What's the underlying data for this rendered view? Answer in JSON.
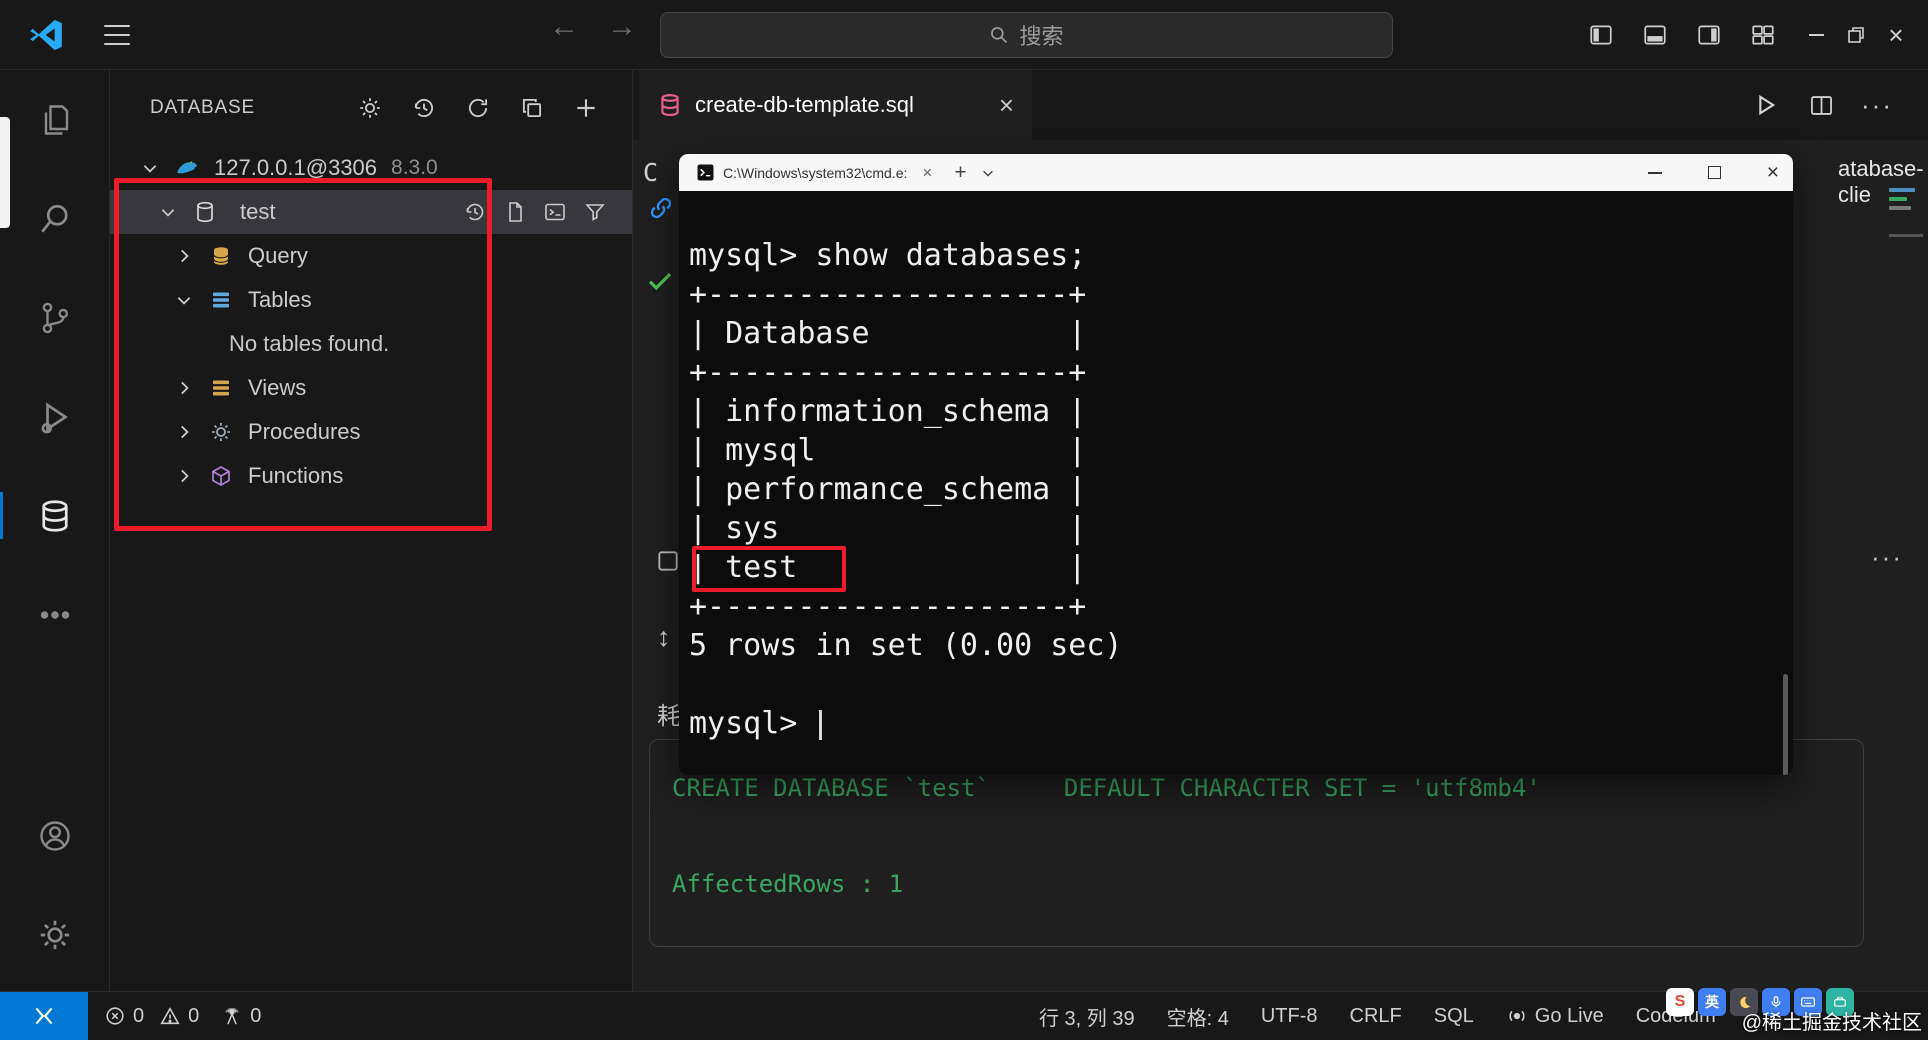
{
  "titlebar": {
    "search_placeholder": "搜索"
  },
  "icons": {
    "back": "←",
    "forward": "→",
    "close": "×",
    "plus": "+",
    "dots": "···",
    "updown": "↕"
  },
  "sidebar": {
    "title": "DATABASE",
    "connection": {
      "host": "127.0.0.1@3306",
      "version": "8.3.0"
    },
    "tree": [
      {
        "label": "test"
      },
      {
        "label": "Query"
      },
      {
        "label": "Tables"
      },
      {
        "label": "No tables found."
      },
      {
        "label": "Views"
      },
      {
        "label": "Procedures"
      },
      {
        "label": "Functions"
      }
    ]
  },
  "editor": {
    "tab_title": "create-db-template.sql",
    "fragment_line1": "C",
    "fragment_elapsed": "耗",
    "right_fragment": "atabase-clie",
    "results": {
      "statement": "CREATE DATABASE `test`",
      "statement_tail": "DEFAULT CHARACTER SET = 'utf8mb4'",
      "affected_rows": "AffectedRows : 1"
    }
  },
  "terminal": {
    "window_title": "C:\\Windows\\system32\\cmd.e:",
    "lines": [
      "mysql> show databases;",
      "+--------------------+",
      "| Database           |",
      "+--------------------+",
      "| information_schema |",
      "| mysql              |",
      "| performance_schema |",
      "| sys                |",
      "| test               |",
      "+--------------------+",
      "5 rows in set (0.00 sec)",
      "",
      "mysql>"
    ]
  },
  "status_bar": {
    "errors": "0",
    "warnings": "0",
    "ports": "0",
    "cursor_position": "行 3, 列 39",
    "indent": "空格: 4",
    "encoding": "UTF-8",
    "eol": "CRLF",
    "language": "SQL",
    "go_live": "Go Live",
    "codeium": "Codeium"
  },
  "ime_bar": {
    "logo": "S",
    "lang": "英"
  },
  "watermark": "@稀土掘金技术社区",
  "colors": {
    "annotation_red": "#ec1c2c",
    "accent_blue": "#0078d4",
    "result_green": "#3aa763",
    "terminal_bg": "#0c0c0c"
  }
}
